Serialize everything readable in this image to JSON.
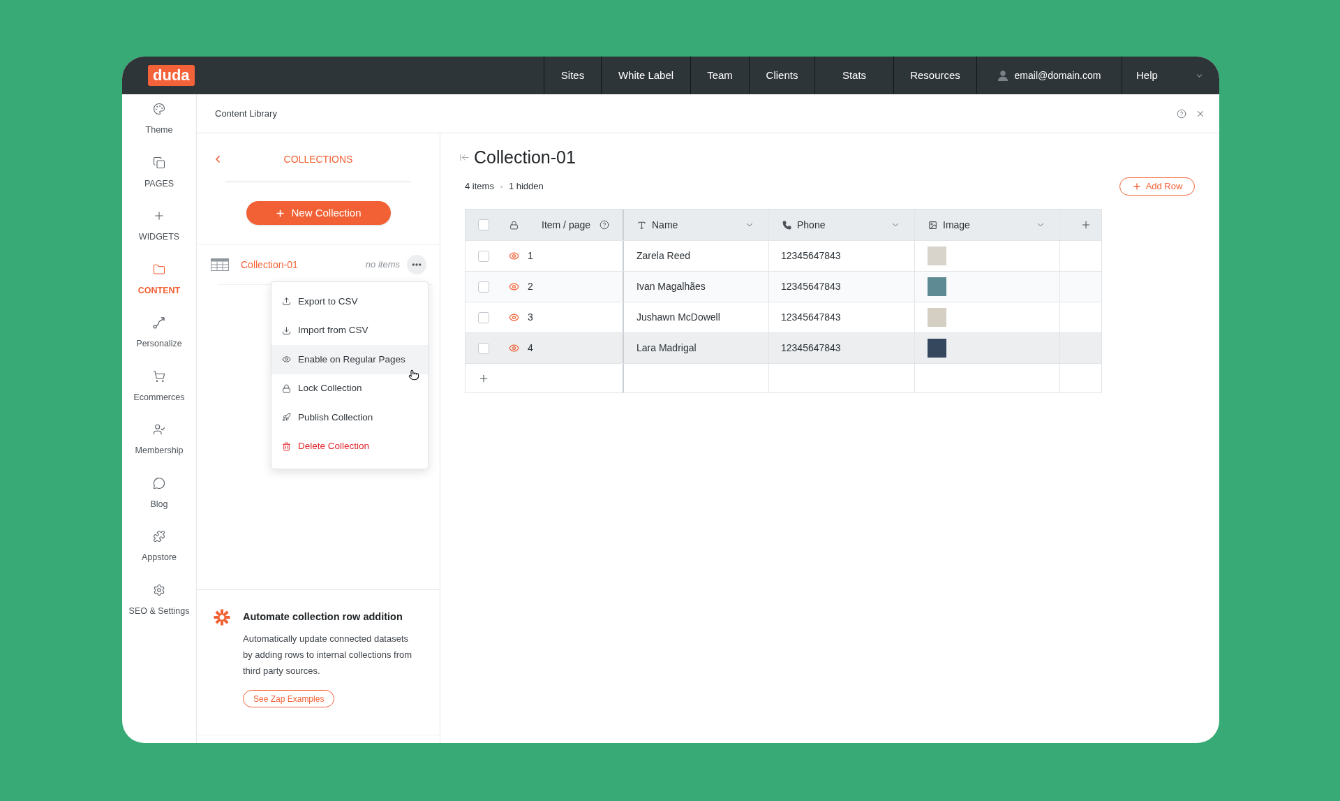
{
  "topbar": {
    "logo": "duda",
    "nav": [
      "Sites",
      "White Label",
      "Team",
      "Clients",
      "Stats",
      "Resources"
    ],
    "account": "email@domain.com",
    "help": "Help"
  },
  "sidebar": {
    "items": [
      {
        "label": "Theme",
        "selected": false
      },
      {
        "label": "PAGES",
        "selected": false
      },
      {
        "label": "WIDGETS",
        "selected": false
      },
      {
        "label": "CONTENT",
        "selected": true
      },
      {
        "label": "Personalize",
        "selected": false
      },
      {
        "label": "Ecommerces",
        "selected": false
      },
      {
        "label": "Membership",
        "selected": false
      },
      {
        "label": "Blog",
        "selected": false
      },
      {
        "label": "Appstore",
        "selected": false
      },
      {
        "label": "SEO & Settings",
        "selected": false
      }
    ]
  },
  "panel": {
    "title": "Content Library"
  },
  "collections": {
    "title": "COLLECTIONS",
    "new_button": "New Collection",
    "items": [
      {
        "name": "Collection-01",
        "count": "no items"
      }
    ],
    "menu": [
      {
        "label": "Export to CSV",
        "kind": "normal",
        "highlighted": false
      },
      {
        "label": "Import from CSV",
        "kind": "normal",
        "highlighted": false
      },
      {
        "label": "Enable on Regular Pages",
        "kind": "normal",
        "highlighted": true
      },
      {
        "label": "Lock Collection",
        "kind": "normal",
        "highlighted": false
      },
      {
        "label": "Publish Collection",
        "kind": "normal",
        "highlighted": false
      },
      {
        "label": "Delete Collection",
        "kind": "danger",
        "highlighted": false
      }
    ]
  },
  "promo": {
    "title": "Automate collection row addition",
    "text": "Automatically update connected datasets by adding rows to internal collections from third party sources.",
    "button": "See Zap Examples"
  },
  "collection": {
    "title": "Collection-01",
    "item_count": "4 items",
    "hidden_count": "1 hidden",
    "add_row_button": "Add Row",
    "table": {
      "select_all_checked": false,
      "columns": [
        {
          "label": "Item / page",
          "kind": "index"
        },
        {
          "label": "Name",
          "kind": "text"
        },
        {
          "label": "Phone",
          "kind": "phone"
        },
        {
          "label": "Image",
          "kind": "image"
        }
      ],
      "rows": [
        {
          "number": "1",
          "name": "Zarela Reed",
          "phone": "12345647843",
          "checked": false,
          "visible": true,
          "highlighted": false
        },
        {
          "number": "2",
          "name": "Ivan Magalhães",
          "phone": "12345647843",
          "checked": false,
          "visible": true,
          "highlighted": false
        },
        {
          "number": "3",
          "name": "Jushawn McDowell",
          "phone": "12345647843",
          "checked": false,
          "visible": true,
          "highlighted": false
        },
        {
          "number": "4",
          "name": "Lara Madrigal",
          "phone": "12345647843",
          "checked": false,
          "visible": true,
          "highlighted": true
        }
      ]
    }
  }
}
